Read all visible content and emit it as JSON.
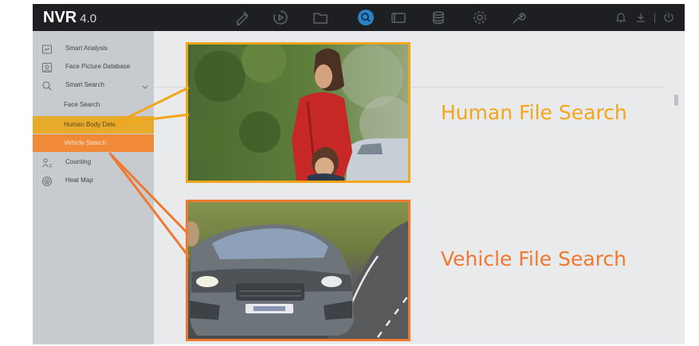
{
  "app": {
    "logo": "NVR",
    "version": "4.0"
  },
  "topbar": {
    "nav_icons": [
      "live-view-icon",
      "playback-icon",
      "file-icon",
      "smart-search-icon",
      "monitor-icon",
      "storage-icon",
      "settings-icon",
      "maintenance-icon"
    ],
    "active": "smart-search-icon",
    "right_icons": [
      "alarm-bell-icon",
      "download-icon",
      "power-icon"
    ]
  },
  "sidebar": {
    "items": [
      {
        "label": "Smart Analysis",
        "icon": "smart-analysis-icon"
      },
      {
        "label": "Face Picture Database",
        "icon": "face-database-icon"
      },
      {
        "label": "Smart Search",
        "icon": "smart-search-menu-icon",
        "expanded": true
      },
      {
        "label": "Counting",
        "icon": "counting-icon"
      },
      {
        "label": "Heat Map",
        "icon": "heat-map-icon"
      }
    ],
    "sub_items": [
      {
        "label": "Face Search",
        "state": "normal"
      },
      {
        "label": "Human Body Dete",
        "state": "highlighted"
      },
      {
        "label": "Vehicle Search",
        "state": "selected"
      }
    ]
  },
  "callouts": {
    "human": "Human File Search",
    "vehicle": "Vehicle File Search"
  },
  "colors": {
    "human_accent": "#f3a61b",
    "vehicle_accent": "#ef7930",
    "topbar": "#1d1f22",
    "sidebar": "#c7cbd0",
    "active_blue": "#2d81c7"
  }
}
